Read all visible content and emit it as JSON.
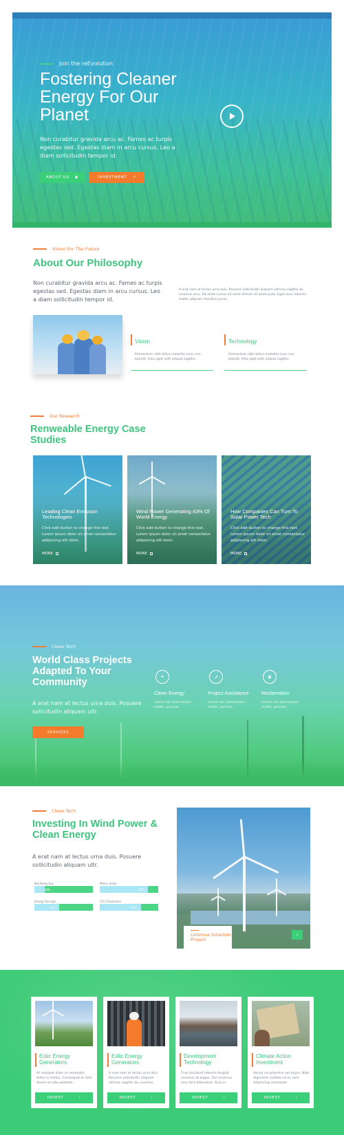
{
  "hero": {
    "eyebrow": "Join the reEvolution",
    "title": "Fostering Cleaner Energy For Our Planet",
    "text": "Non curabitur gravida arcu ac. Fames ac turpis egestas sed. Egestas diam in arcu cursus. Leo a diam sollicitudin tempor id.",
    "about_label": "ABOUT US",
    "invest_label": "INVESTMENT"
  },
  "philosophy": {
    "eyebrow": "Vision For The Future",
    "title": "About Our Philosophy",
    "lead": "Non curabitur gravida arcu ac. Fames ac turpis egestas sed. Egestas diam in arcu cursus. Leo a diam sollicitudin tempor id.",
    "small": "A erat nam at lectus urna duis. Posuere sollicitudin aliquam ultrices sagittis du vivamus arcu. Sit amet cursus sit amet dictum sit amet justo. Eget nunc lobortis mattis aliquam faucibus purus.",
    "features": [
      {
        "title": "Vision",
        "text": "Elementum nibh tellus molestie nunc non blandit. Felis eget velit aliquet sagittis."
      },
      {
        "title": "Technology",
        "text": "Elementum nibh tellus molestie nunc non blandit. Felis eget velit aliquet sagittis."
      }
    ]
  },
  "research": {
    "eyebrow": "Our Research",
    "title": "Renweable Energy Case Studies",
    "cards": [
      {
        "title": "Leading Clean Emission Technologies",
        "text": "Click edit button to change this text. Lorem ipsum dolor sit amet consectetur adipiscing elit dolor.",
        "more": "MORE"
      },
      {
        "title": "Wind Power Generating 43% Of World Energy",
        "text": "Click edit button to change this text. Lorem ipsum dolor sit amet consectetur adipiscing elit dolor.",
        "more": "MORE"
      },
      {
        "title": "How Companies Can Turn To Solar Power Tech",
        "text": "Click edit button to change this text. Lorem ipsum dolor sit amet consectetur adipiscing elit dolor.",
        "more": "MORE"
      }
    ]
  },
  "world": {
    "eyebrow": "Clean Tech",
    "title": "World Class Projects Adapted To Your Community",
    "text": "A erat nam at lectus urna duis. Posuere sollicitudin aliquam ultr.",
    "services_label": "SERVICES",
    "features": [
      {
        "icon": "pin-icon",
        "title": "Clean Energy",
        "text": "Luctus nec ullamcorper mattis, pulvinar."
      },
      {
        "icon": "chart-icon",
        "title": "Project Assistance",
        "text": "Luctus nec ullamcorper mattis, pulvinar."
      },
      {
        "icon": "leaf-icon",
        "title": "Reclamation",
        "text": "Luctus nec ullamcorper mattis, pulvinar."
      }
    ]
  },
  "investing": {
    "eyebrow": "Clean Tech",
    "title": "Investing In Wind Power & Clean Energy",
    "text": "A erat nam at lectus urna duis. Posuere sollicitudin aliquam ultr.",
    "meters": [
      {
        "label": "Net Reduction",
        "value": 18,
        "value_label": "18%"
      },
      {
        "label": "Metric Index",
        "value": 82,
        "value_label": "82%"
      },
      {
        "label": "Energy Savings",
        "value": 42,
        "value_label": "42%"
      },
      {
        "label": "CO 2 Reduction",
        "value": 70,
        "value_label": "70%"
      }
    ],
    "caption": "Loremus Solarium Project",
    "arrow": "›"
  },
  "products": [
    {
      "title": "Eolic Energy Generators",
      "text": "At volutpat diam ut venenatis tellus in metus. Consequat ac felis donec et odio pellente.",
      "button": "INVEST"
    },
    {
      "title": "Eolic Energy Generators",
      "text": "A erat nam at lectus urna duis. Posuere sollicitudin aliquam ultrices sagittis du vivamus.",
      "button": "INVEST"
    },
    {
      "title": "Development Technology",
      "text": "Cras tincidunt lobortis feugiat vivamus at augue. Dui vivamus arcu felis bibendum. Eros in.",
      "button": "INVEST"
    },
    {
      "title": "Climate Action Investment",
      "text": "Varius vel pharetra vel turpis. Nibh dignissim sodales ut eu sem. Adipiscing commodo.",
      "button": "INVEST"
    }
  ],
  "colors": {
    "green": "#3fc47f",
    "orange": "#f47a2c",
    "blue": "#3b9bd6"
  }
}
